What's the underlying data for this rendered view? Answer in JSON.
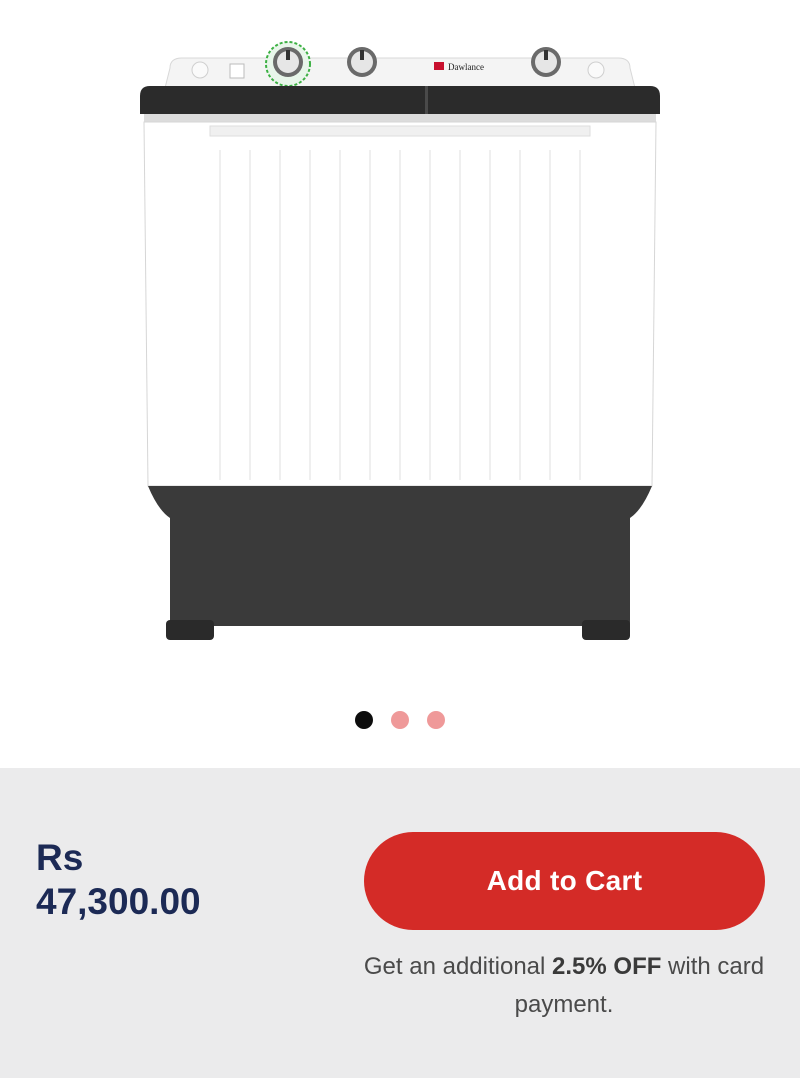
{
  "gallery": {
    "image": "washing-machine-product-photo",
    "brand_on_panel": "Dawlance",
    "dots": [
      {
        "state": "active"
      },
      {
        "state": "inactive"
      },
      {
        "state": "inactive"
      }
    ],
    "active_index": 0
  },
  "purchase": {
    "currency": "Rs",
    "amount": "47,300.00",
    "add_to_cart_label": "Add to Cart",
    "offer_prefix": "Get an additional ",
    "offer_highlight": "2.5% OFF",
    "offer_suffix": " with card payment."
  },
  "colors": {
    "accent": "#d42b27",
    "price_text": "#1c2a55",
    "dot_active": "#0d0d0d",
    "dot_inactive": "#ef9999",
    "panel_bg": "#ebebec"
  }
}
